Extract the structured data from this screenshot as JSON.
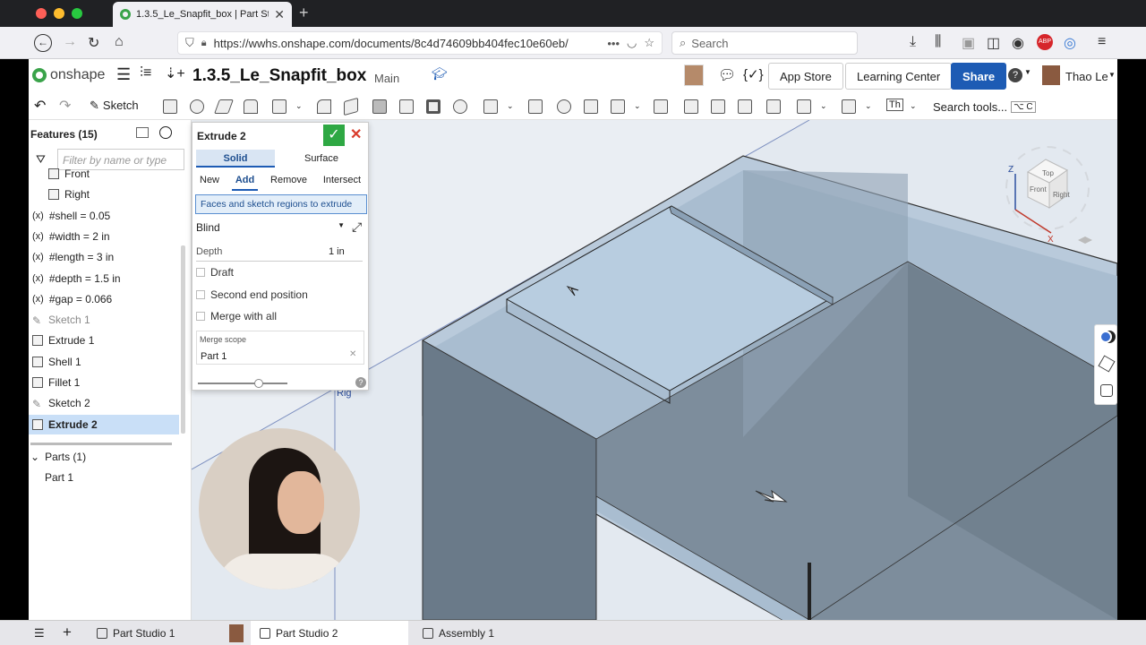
{
  "browser": {
    "tab_title": "1.3.5_Le_Snapfit_box | Part Stud",
    "url": "https://wwhs.onshape.com/documents/8c4d74609bb404fec10e60eb/",
    "search_placeholder": "Search"
  },
  "app": {
    "logo": "onshape",
    "document_name": "1.3.5_Le_Snapfit_box",
    "workspace": "Main",
    "app_store": "App Store",
    "learning_center": "Learning Center",
    "share": "Share",
    "user": "Thao Le"
  },
  "toolbar": {
    "sketch": "Sketch",
    "search_tools": "Search tools...",
    "shortcut": "⌥ C",
    "text_tool": "Th"
  },
  "features": {
    "header": "Features (15)",
    "filter_placeholder": "Filter by name or type",
    "items": [
      {
        "label": "Front",
        "kind": "plane"
      },
      {
        "label": "Right",
        "kind": "plane"
      },
      {
        "label": "#shell = 0.05",
        "kind": "variable"
      },
      {
        "label": "#width = 2 in",
        "kind": "variable"
      },
      {
        "label": "#length = 3 in",
        "kind": "variable"
      },
      {
        "label": "#depth = 1.5 in",
        "kind": "variable"
      },
      {
        "label": "#gap = 0.066",
        "kind": "variable"
      },
      {
        "label": "Sketch 1",
        "kind": "sketch"
      },
      {
        "label": "Extrude 1",
        "kind": "extrude"
      },
      {
        "label": "Shell 1",
        "kind": "shell"
      },
      {
        "label": "Fillet 1",
        "kind": "fillet"
      },
      {
        "label": "Sketch 2",
        "kind": "sketch"
      },
      {
        "label": "Extrude 2",
        "kind": "extrude"
      }
    ],
    "variable_prefix": "(x)",
    "parts_header": "Parts (1)",
    "parts": [
      "Part 1"
    ]
  },
  "dialog": {
    "title": "Extrude 2",
    "tab_solid": "Solid",
    "tab_surface": "Surface",
    "ops": [
      "New",
      "Add",
      "Remove",
      "Intersect"
    ],
    "active_op": "Add",
    "selection_hint": "Faces and sketch regions to extrude",
    "end_type": "Blind",
    "depth_label": "Depth",
    "depth_value": "1 in",
    "draft": "Draft",
    "second_end": "Second end position",
    "merge_all": "Merge with all",
    "merge_scope_label": "Merge scope",
    "merge_scope_value": "Part 1",
    "opacity_level": 0.7
  },
  "viewport": {
    "plane_label": "Rig",
    "viewcube": {
      "top": "Top",
      "front": "Front",
      "right": "Right",
      "z": "Z",
      "x": "X"
    }
  },
  "bottom_tabs": [
    {
      "label": "Part Studio 1",
      "active": false
    },
    {
      "label": "Part Studio 2",
      "active": true
    },
    {
      "label": "Assembly 1",
      "active": false
    }
  ],
  "colors": {
    "accent": "#1d5bb4",
    "confirm": "#2ea843",
    "cancel": "#d93b2b",
    "selected_row": "#c9dff7",
    "part": "#9fb6c8"
  }
}
